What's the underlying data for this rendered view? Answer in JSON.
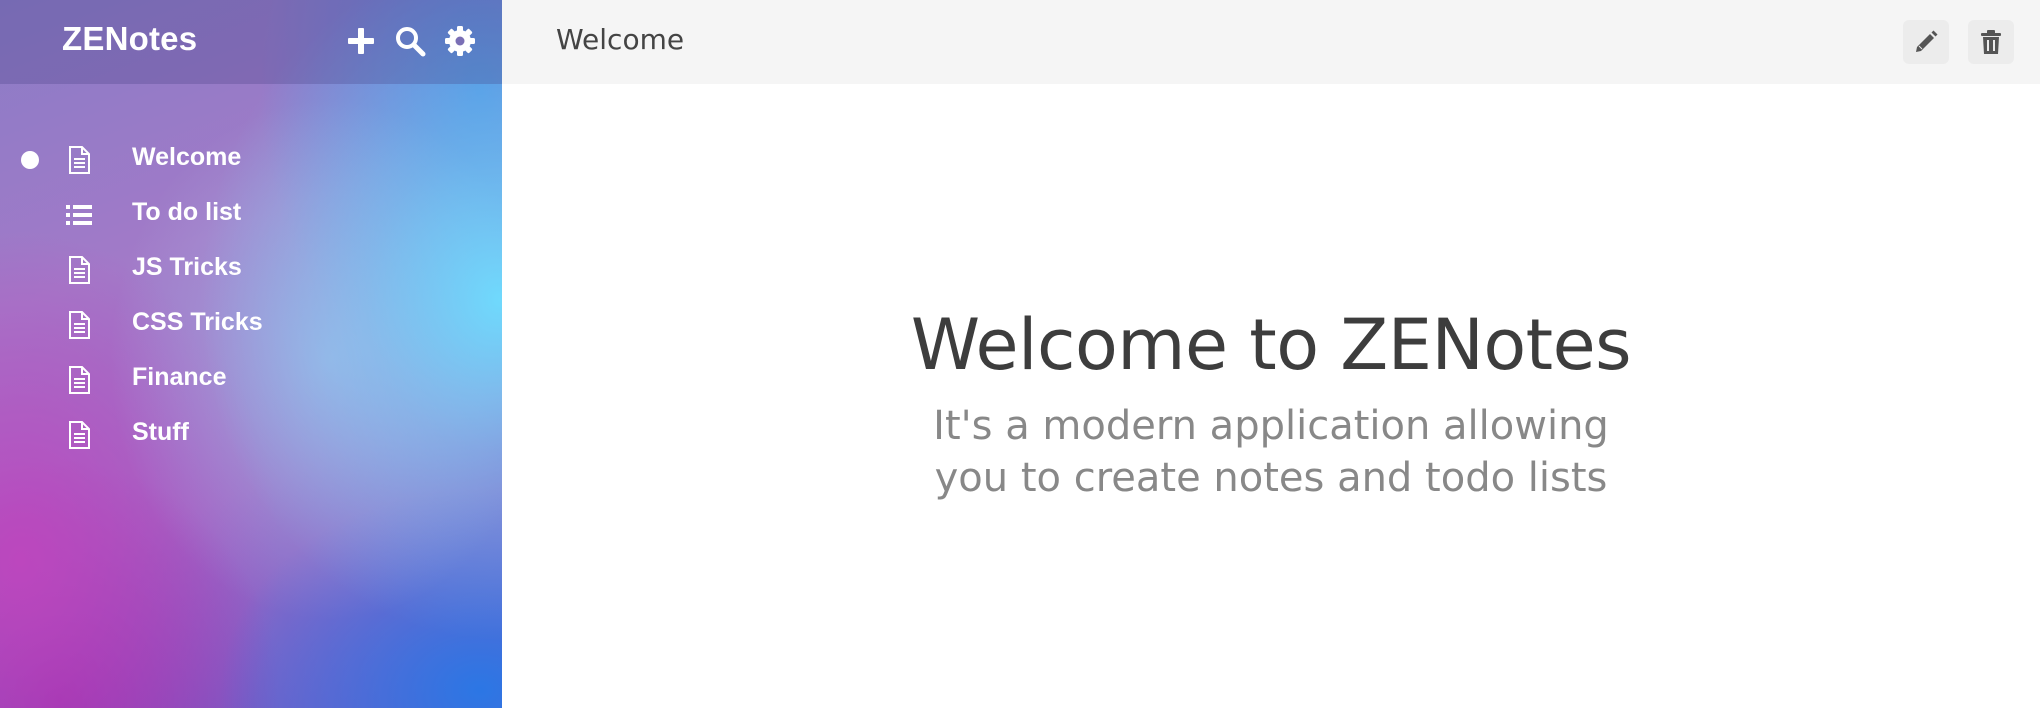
{
  "app": {
    "name": "ZENotes"
  },
  "sidebar": {
    "header_icons": [
      "plus-icon",
      "search-icon",
      "gear-icon"
    ],
    "notes": [
      {
        "label": "Welcome",
        "icon": "document-icon",
        "active": true
      },
      {
        "label": "To do list",
        "icon": "list-icon",
        "active": false
      },
      {
        "label": "JS Tricks",
        "icon": "document-icon",
        "active": false
      },
      {
        "label": "CSS Tricks",
        "icon": "document-icon",
        "active": false
      },
      {
        "label": "Finance",
        "icon": "document-icon",
        "active": false
      },
      {
        "label": "Stuff",
        "icon": "document-icon",
        "active": false
      }
    ]
  },
  "main": {
    "note_title": "Welcome",
    "actions": [
      "pencil-icon",
      "trash-icon"
    ],
    "content": {
      "heading": "Welcome to ZENotes",
      "subheading": "It's a modern application allowing you to create notes and todo lists"
    }
  },
  "colors": {
    "sidebar_text": "#ffffff",
    "topbar_bg": "#f5f5f5",
    "heading": "#3d3d3d",
    "subheading": "#888888",
    "action_icon": "#555555"
  }
}
